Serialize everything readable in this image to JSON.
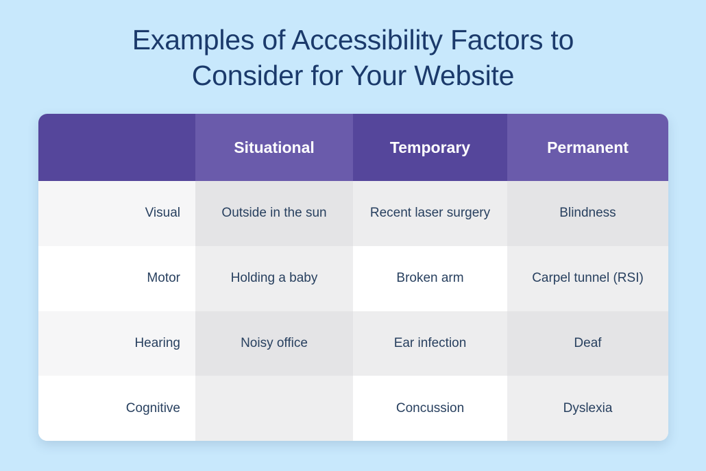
{
  "background_color": "#c8e8fc",
  "title": {
    "text": "Examples of Accessibility Factors to\nConsider for Your Website",
    "color": "#1b3a6b"
  },
  "table": {
    "header_color_dark": "#55469b",
    "header_color_light": "#6a5bab",
    "header_text_color": "#ffffff",
    "body_text_color": "#28405f",
    "columns": [
      {
        "label": ""
      },
      {
        "label": "Situational"
      },
      {
        "label": "Temporary"
      },
      {
        "label": "Permanent"
      }
    ],
    "rows": [
      {
        "category": "Visual",
        "situational": "Outside in the sun",
        "temporary": "Recent laser surgery",
        "permanent": "Blindness"
      },
      {
        "category": "Motor",
        "situational": "Holding a baby",
        "temporary": "Broken arm",
        "permanent": "Carpel tunnel (RSI)"
      },
      {
        "category": "Hearing",
        "situational": "Noisy office",
        "temporary": "Ear infection",
        "permanent": "Deaf"
      },
      {
        "category": "Cognitive",
        "situational": "",
        "temporary": "Concussion",
        "permanent": "Dyslexia"
      }
    ]
  }
}
